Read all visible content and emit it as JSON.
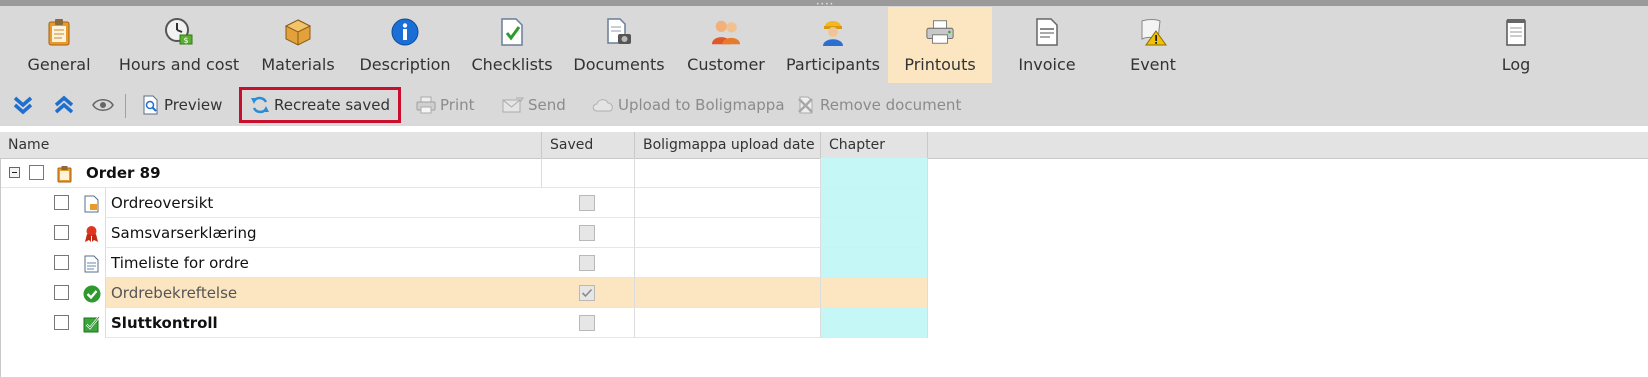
{
  "ribbon": {
    "tabs": [
      {
        "label": "General",
        "icon": "clipboard-icon"
      },
      {
        "label": "Hours and cost",
        "icon": "clock-money-icon"
      },
      {
        "label": "Materials",
        "icon": "box-icon"
      },
      {
        "label": "Description",
        "icon": "info-icon"
      },
      {
        "label": "Checklists",
        "icon": "checklist-icon"
      },
      {
        "label": "Documents",
        "icon": "documents-icon"
      },
      {
        "label": "Customer",
        "icon": "customer-icon"
      },
      {
        "label": "Participants",
        "icon": "participants-icon"
      },
      {
        "label": "Printouts",
        "icon": "printer-icon",
        "active": true
      },
      {
        "label": "Invoice",
        "icon": "invoice-icon"
      },
      {
        "label": "Event",
        "icon": "event-icon"
      },
      {
        "label": "Log",
        "icon": "log-icon"
      }
    ]
  },
  "toolbar": {
    "expand_all_icon": "double-chevron-down-icon",
    "collapse_all_icon": "double-chevron-up-icon",
    "view_icon": "eye-icon",
    "preview_label": "Preview",
    "recreate_label": "Recreate saved",
    "print_label": "Print",
    "send_label": "Send",
    "upload_label": "Upload to Boligmappa",
    "remove_label": "Remove document"
  },
  "grid": {
    "columns": [
      "Name",
      "Saved",
      "Boligmappa upload date",
      "Chapter"
    ],
    "root": {
      "label": "Order 89"
    },
    "rows": [
      {
        "label": "Ordreoversikt",
        "icon": "document-icon",
        "bold": false,
        "saved": false,
        "selected": false
      },
      {
        "label": "Samsvarserklæring",
        "icon": "ribbon-award-icon",
        "bold": false,
        "saved": false,
        "selected": false
      },
      {
        "label": "Timeliste for ordre",
        "icon": "timesheet-icon",
        "bold": false,
        "saved": false,
        "selected": false
      },
      {
        "label": "Ordrebekreftelse",
        "icon": "green-check-icon",
        "bold": false,
        "saved": true,
        "selected": true
      },
      {
        "label": "Sluttkontroll",
        "icon": "checkbox-checked-icon",
        "bold": true,
        "saved": false,
        "selected": false
      }
    ]
  },
  "colors": {
    "ribbon_bg": "#d9d9d9",
    "active_tab": "#fbe6c1",
    "chapter_bg": "#c6f7f7",
    "highlight_outline": "#c8102e",
    "selected_row": "#fbe6c1"
  }
}
